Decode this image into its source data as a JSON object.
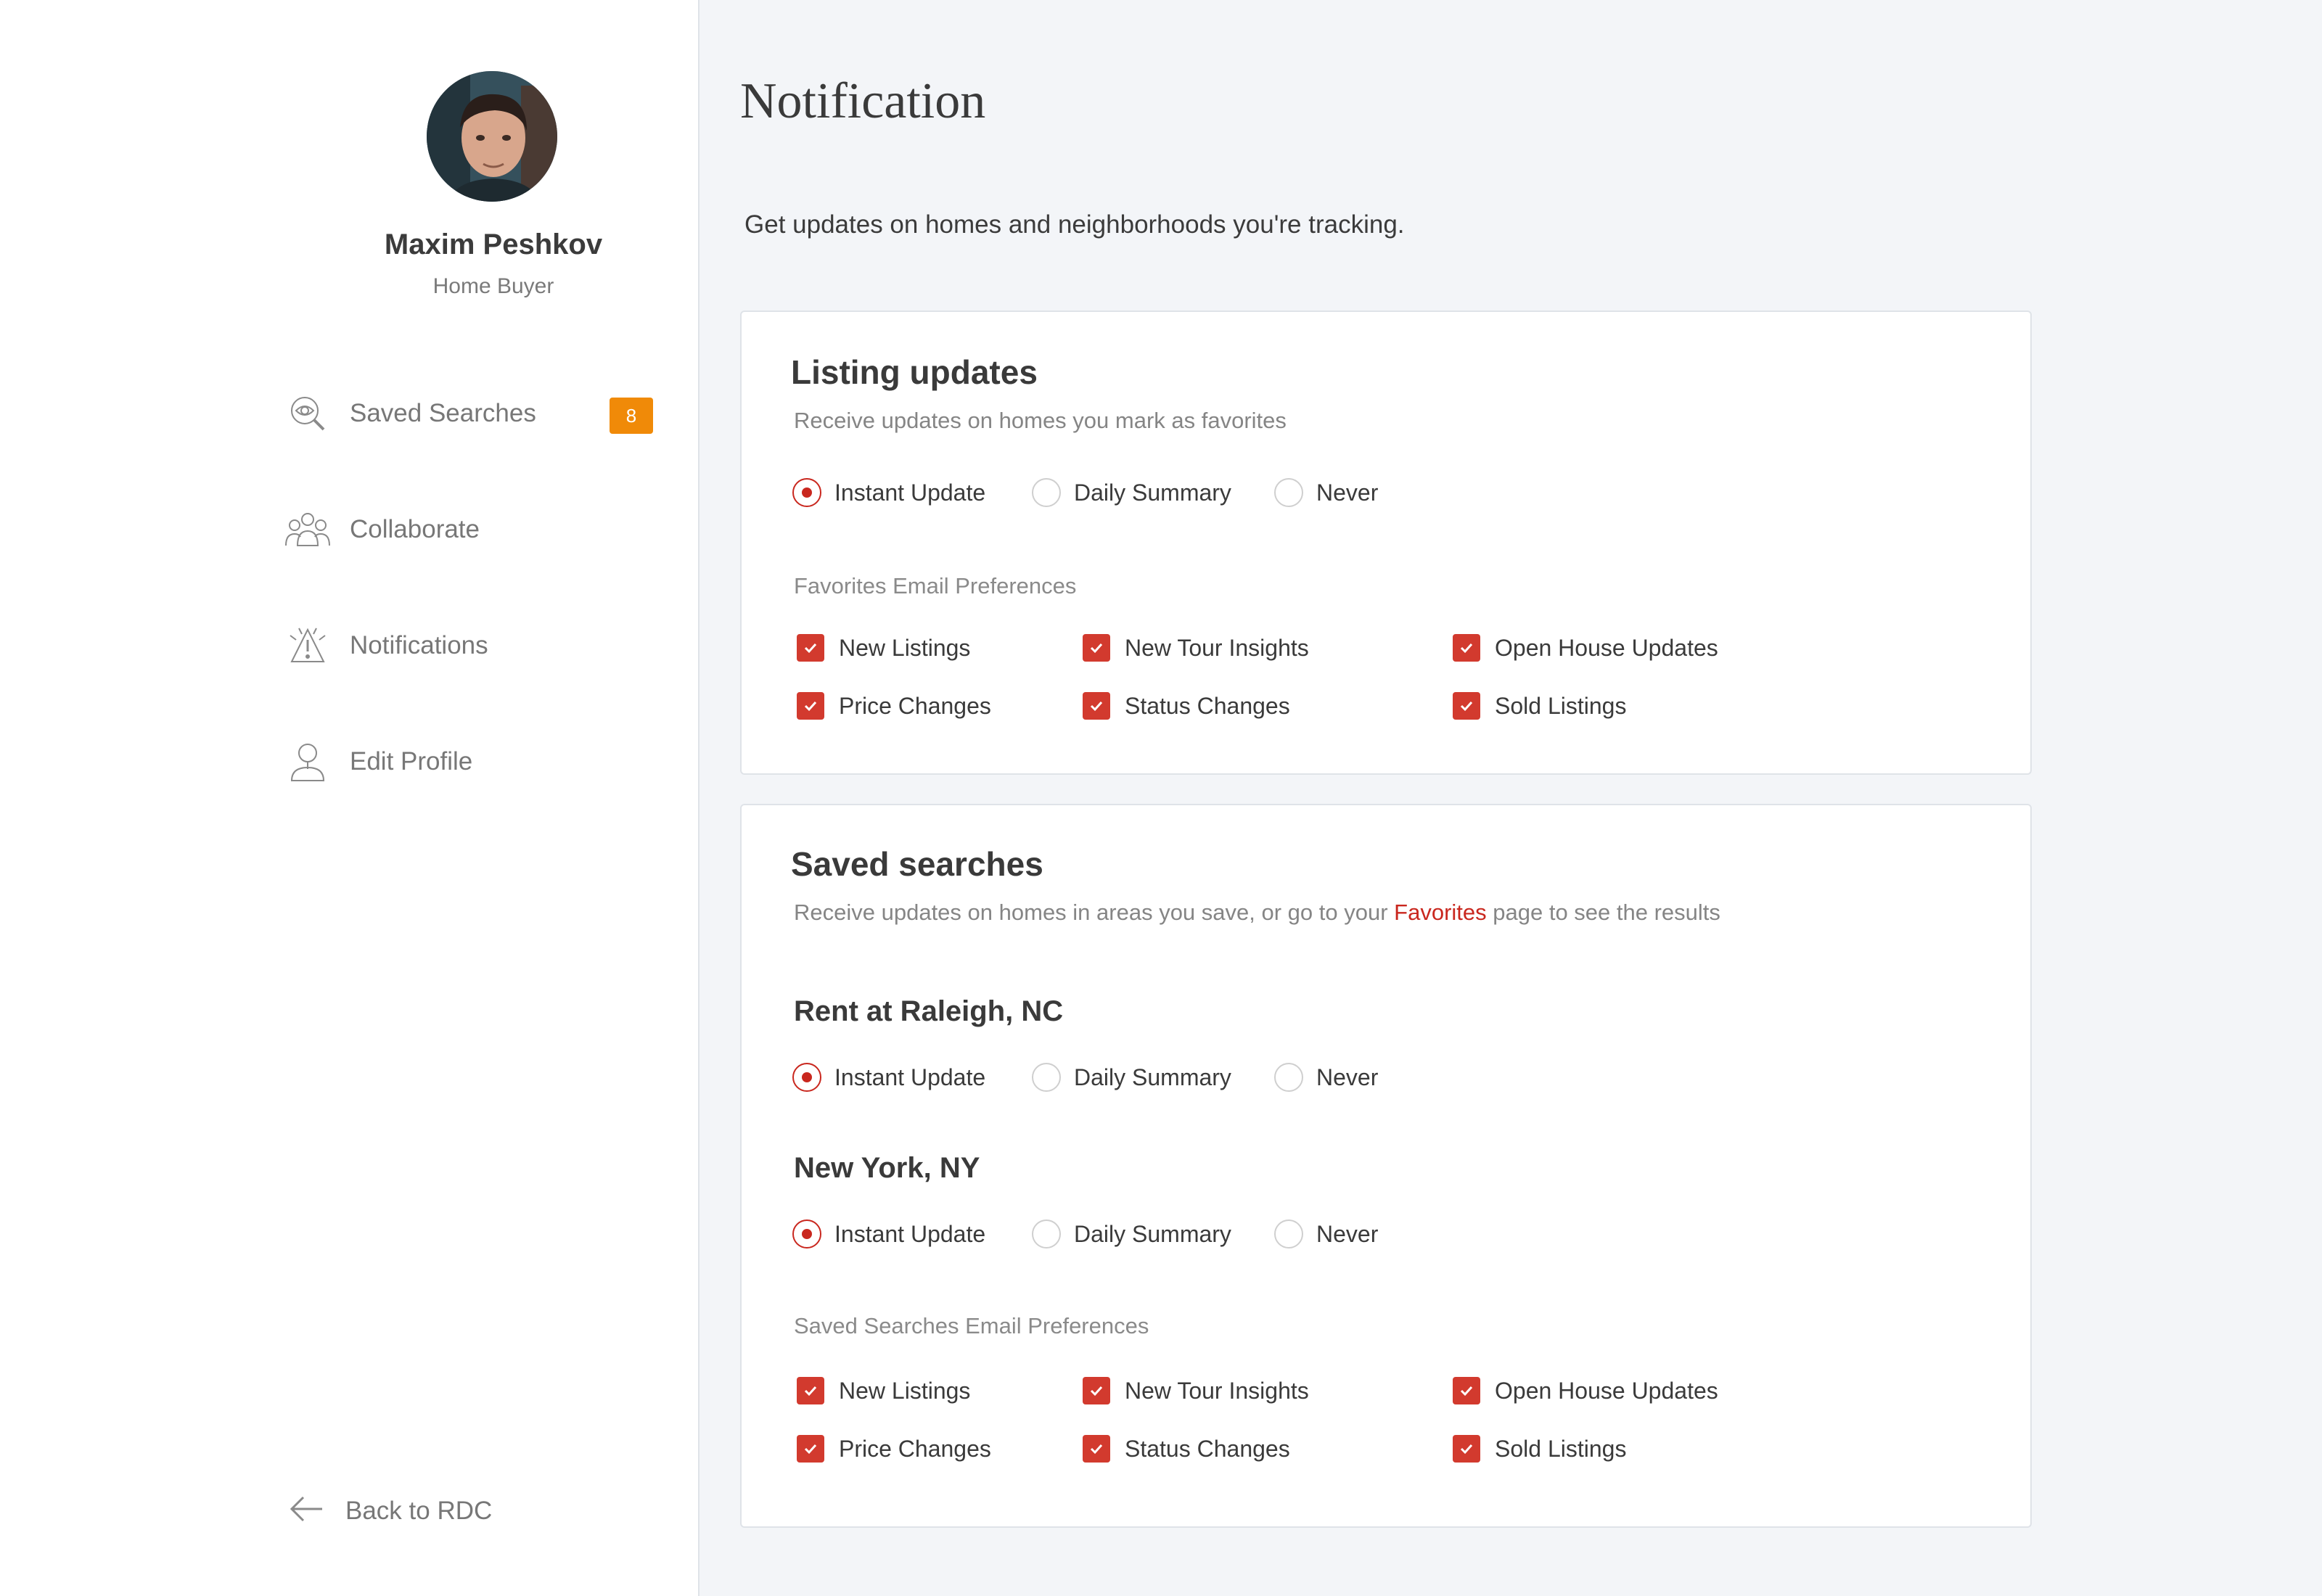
{
  "user": {
    "name": "Maxim Peshkov",
    "role": "Home Buyer"
  },
  "nav": {
    "items": [
      {
        "label": "Saved Searches",
        "icon": "saved-search-icon",
        "badge": "8"
      },
      {
        "label": "Collaborate",
        "icon": "collaborate-icon"
      },
      {
        "label": "Notifications",
        "icon": "notification-icon"
      },
      {
        "label": "Edit Profile",
        "icon": "profile-icon"
      }
    ],
    "back_label": "Back to RDC"
  },
  "page": {
    "title": "Notification",
    "subtitle": "Get updates on homes and neighborhoods you're tracking."
  },
  "listing_updates": {
    "title": "Listing updates",
    "description": "Receive updates on homes you mark as favorites",
    "frequency": {
      "options": [
        "Instant Update",
        "Daily Summary",
        "Never"
      ],
      "selected": "Instant Update"
    },
    "prefs_label": "Favorites Email Preferences",
    "prefs": [
      {
        "label": "New Listings",
        "checked": true
      },
      {
        "label": "New Tour Insights",
        "checked": true
      },
      {
        "label": "Open House Updates",
        "checked": true
      },
      {
        "label": "Price Changes",
        "checked": true
      },
      {
        "label": "Status Changes",
        "checked": true
      },
      {
        "label": "Sold Listings",
        "checked": true
      }
    ]
  },
  "saved_searches": {
    "title": "Saved searches",
    "description_prefix": "Receive updates on homes in areas you save, or go to your ",
    "description_link": "Favorites",
    "description_suffix": " page to see the results",
    "searches": [
      {
        "name": "Rent at Raleigh, NC",
        "options": [
          "Instant Update",
          "Daily Summary",
          "Never"
        ],
        "selected": "Instant Update"
      },
      {
        "name": "New York, NY",
        "options": [
          "Instant Update",
          "Daily Summary",
          "Never"
        ],
        "selected": "Instant Update"
      }
    ],
    "prefs_label": "Saved Searches Email Preferences",
    "prefs": [
      {
        "label": "New Listings",
        "checked": true
      },
      {
        "label": "New Tour Insights",
        "checked": true
      },
      {
        "label": "Open House Updates",
        "checked": true
      },
      {
        "label": "Price Changes",
        "checked": true
      },
      {
        "label": "Status Changes",
        "checked": true
      },
      {
        "label": "Sold Listings",
        "checked": true
      }
    ]
  },
  "colors": {
    "accent": "#c9271e",
    "badge": "#f08a08",
    "checkbox": "#d23a2e"
  }
}
